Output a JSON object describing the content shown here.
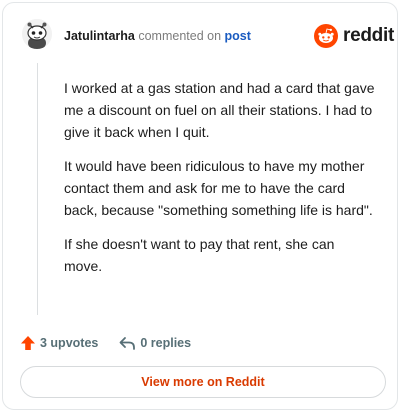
{
  "comment": {
    "username": "Jatulintarha",
    "action_text": "commented on",
    "post_link": "post",
    "paragraphs": [
      "I worked at a gas station and had a card that gave me a discount on fuel on all their stations. I had to give it back when I quit.",
      "It would have been ridiculous to have my mother contact them and ask for me to have the card back, because \"something something life is hard\".",
      "If she doesn't want to pay that rent, she can move."
    ]
  },
  "brand": {
    "name": "reddit",
    "icon": "reddit-snoo-icon",
    "color": "#ff4500"
  },
  "actions": {
    "upvotes": "3 upvotes",
    "replies": "0 replies",
    "upvote_icon": "upvote-arrow-icon",
    "reply_icon": "reply-arrow-icon",
    "upvote_color": "#ff4500"
  },
  "footer": {
    "view_more": "View more on Reddit",
    "view_more_color": "#d93a00"
  }
}
